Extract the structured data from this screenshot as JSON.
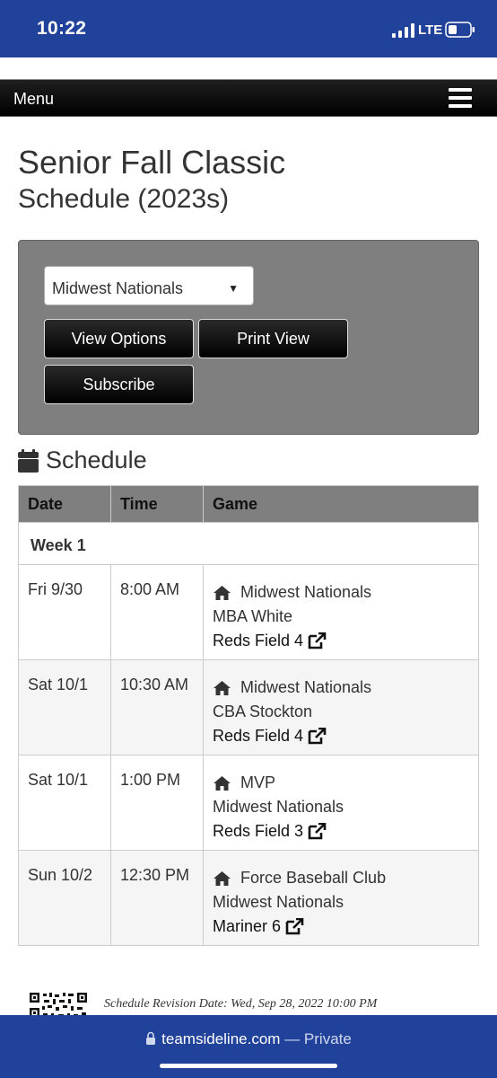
{
  "status_bar": {
    "time": "10:22",
    "network": "LTE"
  },
  "nav": {
    "menu_label": "Menu"
  },
  "page": {
    "title": "Senior Fall Classic",
    "subtitle": "Schedule (2023s)"
  },
  "controls": {
    "team_select": "Midwest Nationals",
    "view_options": "View Options",
    "print_view": "Print View",
    "subscribe": "Subscribe"
  },
  "schedule": {
    "heading": "Schedule",
    "columns": [
      "Date",
      "Time",
      "Game"
    ],
    "week_label": "Week 1",
    "rows": [
      {
        "date": "Fri 9/30",
        "time": "8:00 AM",
        "home": "Midwest Nationals",
        "away": "MBA White",
        "field": "Reds Field 4"
      },
      {
        "date": "Sat 10/1",
        "time": "10:30 AM",
        "home": "Midwest Nationals",
        "away": "CBA Stockton",
        "field": "Reds Field 4"
      },
      {
        "date": "Sat 10/1",
        "time": "1:00 PM",
        "home": "MVP",
        "away": "Midwest Nationals",
        "field": "Reds Field 3"
      },
      {
        "date": "Sun 10/2",
        "time": "12:30 PM",
        "home": "Force Baseball Club",
        "away": "Midwest Nationals",
        "field": "Mariner 6"
      }
    ]
  },
  "footer": {
    "revision": "Schedule Revision Date: Wed, Sep 28, 2022 10:00 PM"
  },
  "browser": {
    "host": "teamsideline.com",
    "mode": "— Private"
  },
  "colors": {
    "status_bar_bg": "#21429a",
    "panel_bg": "#7f7f7f",
    "button_bg": "#000000"
  },
  "icons": [
    "signal-icon",
    "battery-icon",
    "hamburger-icon",
    "calendar-icon",
    "home-icon",
    "external-link-icon",
    "qr-code-icon",
    "lock-icon"
  ]
}
